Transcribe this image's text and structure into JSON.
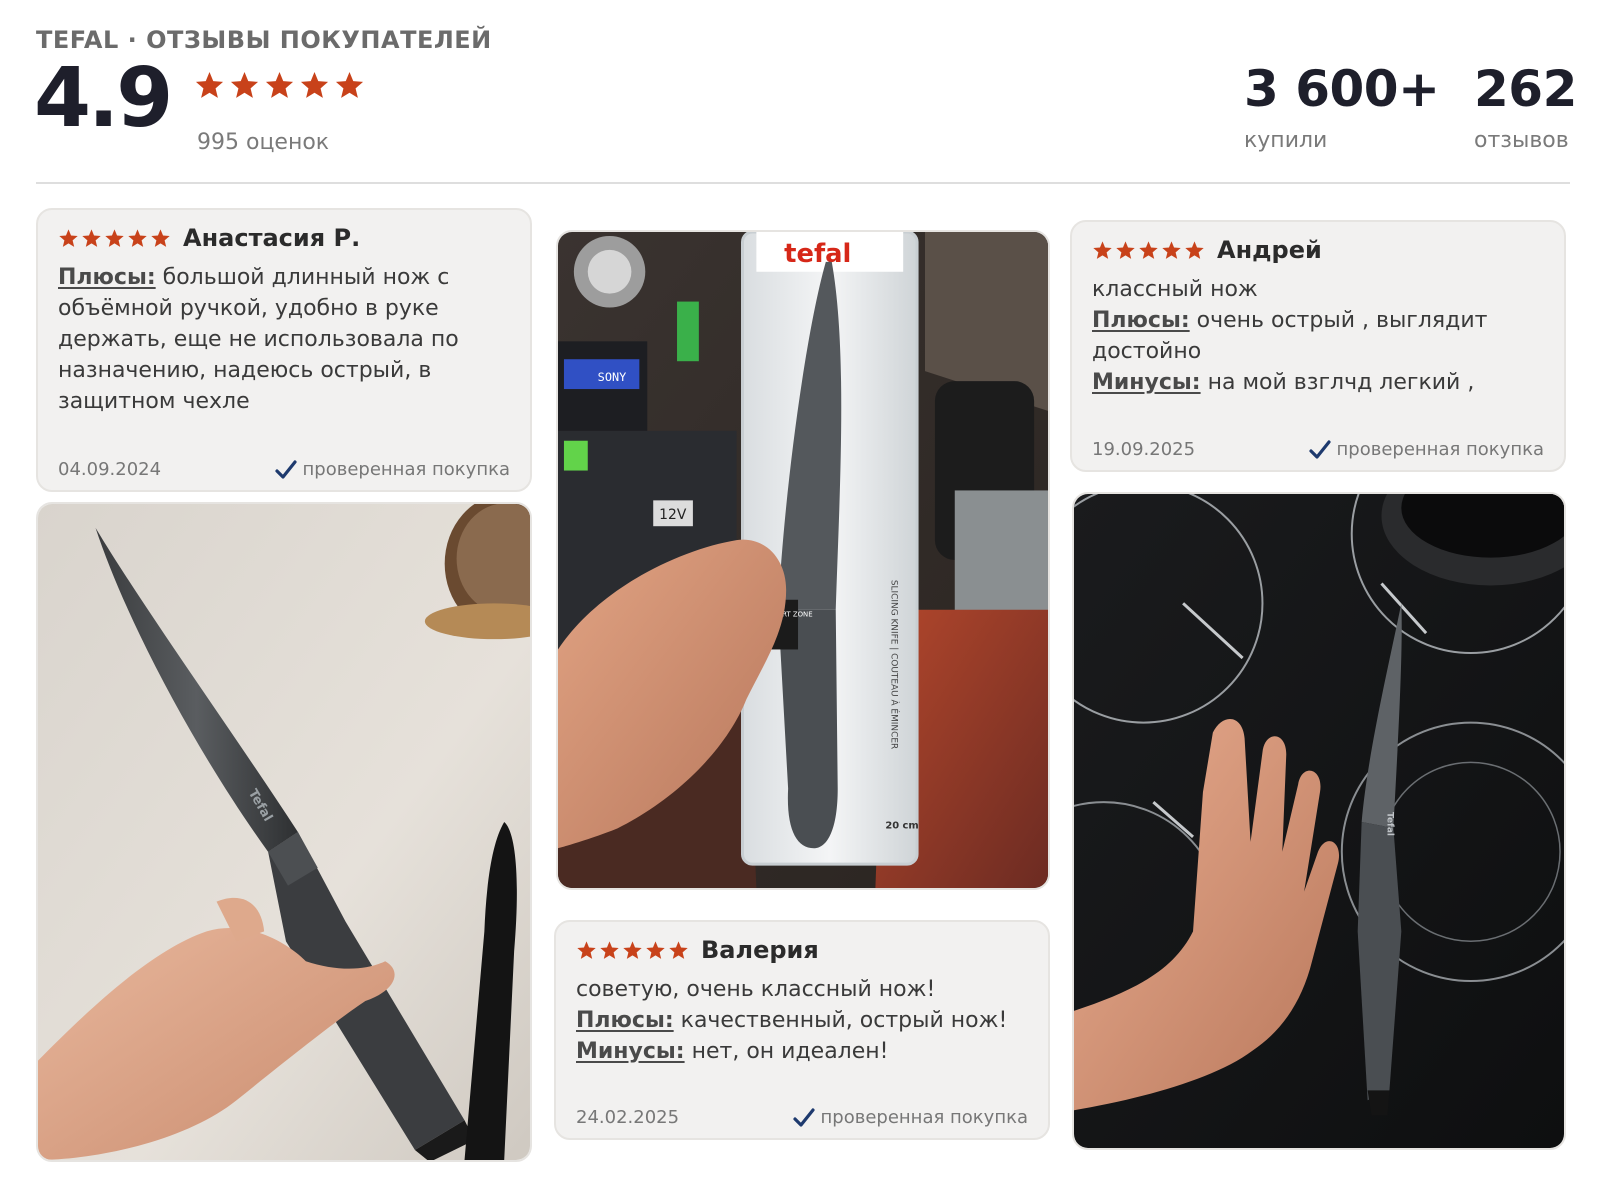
{
  "header": {
    "brand_title": "TEFAL · ОТЗЫВЫ ПОКУПАТЕЛЕЙ",
    "rating": "4.9",
    "ratings_count": "995 оценок",
    "bought_value": "3 600+",
    "bought_label": "купили",
    "reviews_value": "262",
    "reviews_label": "отзывов",
    "stars": 5
  },
  "reviews": [
    {
      "author": "Анастасия Р.",
      "stars": 5,
      "pros_label": "Плюсы:",
      "pros_lines": [
        "большой длинный нож с",
        "объёмной ручкой, удобно в руке",
        "держать, еще не использовала по",
        "назначению, надеюсь острый, в",
        "защитном чехле"
      ],
      "date": "04.09.2024",
      "verified": "проверенная покупка"
    },
    {
      "author": "Андрей",
      "stars": 5,
      "comment": "классный нож",
      "pros_label": "Плюсы:",
      "pros_lines": [
        "очень острый , выглядит",
        "достойно"
      ],
      "cons_label": "Минусы:",
      "cons": "на мой взглчд легкий ,",
      "date": "19.09.2025",
      "verified": "проверенная покупка"
    },
    {
      "author": "Валерия",
      "stars": 5,
      "comment": "советую, очень классный нож!",
      "pros_label": "Плюсы:",
      "pros": "качественный, острый нож!",
      "cons_label": "Минусы:",
      "cons": "нет, он идеален!",
      "date": "24.02.2025",
      "verified": "проверенная покупка"
    }
  ],
  "photos": {
    "package_brand": "tefal",
    "package_comfort": "COMFORT ZONE",
    "package_size": "20 cm",
    "package_side": "SLICING KNIFE | COUTEAU À ÉMINCER",
    "blade_brand": "Tefal",
    "voltage_label": "12V",
    "sony_label": "SONY"
  },
  "colors": {
    "star": "#c8421a",
    "check": "#1e3a6e",
    "card_bg": "#f2f1f0",
    "rating_text": "#1e1f2b"
  }
}
